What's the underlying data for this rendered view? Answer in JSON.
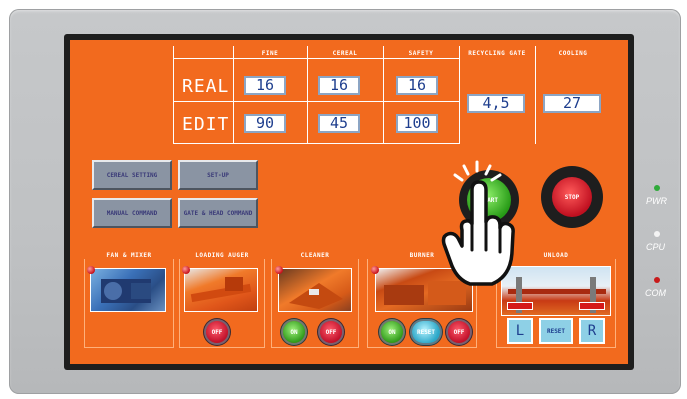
{
  "top_table": {
    "headers": [
      "FINE",
      "CEREAL",
      "SAFETY",
      "RECYCLING GATE",
      "COOLING"
    ],
    "rows": [
      {
        "label": "REAL",
        "values": [
          "16",
          "16",
          "16"
        ]
      },
      {
        "label": "EDIT",
        "values": [
          "90",
          "45",
          "100"
        ]
      }
    ],
    "recycling_gate_value": "4,5",
    "cooling_value": "27"
  },
  "command_buttons": {
    "cereal_setting": "CEREAL SETTING",
    "set_up": "SET-UP",
    "manual_command": "MANUAL COMMAND",
    "gate_head_command": "GATE & HEAD COMMAND"
  },
  "main_buttons": {
    "start": "START",
    "stop": "STOP"
  },
  "sections": {
    "fan_mixer": {
      "label": "FAN & MIXER"
    },
    "loading_auger": {
      "label": "LOADING AUGER",
      "off": "OFF"
    },
    "cleaner": {
      "label": "CLEANER",
      "on": "ON",
      "off": "OFF"
    },
    "burner": {
      "label": "BURNER",
      "on": "ON",
      "reset": "RESET",
      "off": "OFF"
    },
    "unload": {
      "label": "UNLOAD",
      "left": "L",
      "reset": "RESET",
      "right": "R"
    }
  },
  "status_leds": [
    {
      "label": "PWR",
      "color": "#2faa3a"
    },
    {
      "label": "CPU",
      "color": "#f4f4f4"
    },
    {
      "label": "COM",
      "color": "#c81a1a"
    }
  ],
  "colors": {
    "screen": "#f26a1e",
    "bezel": "#c3c5c7"
  }
}
